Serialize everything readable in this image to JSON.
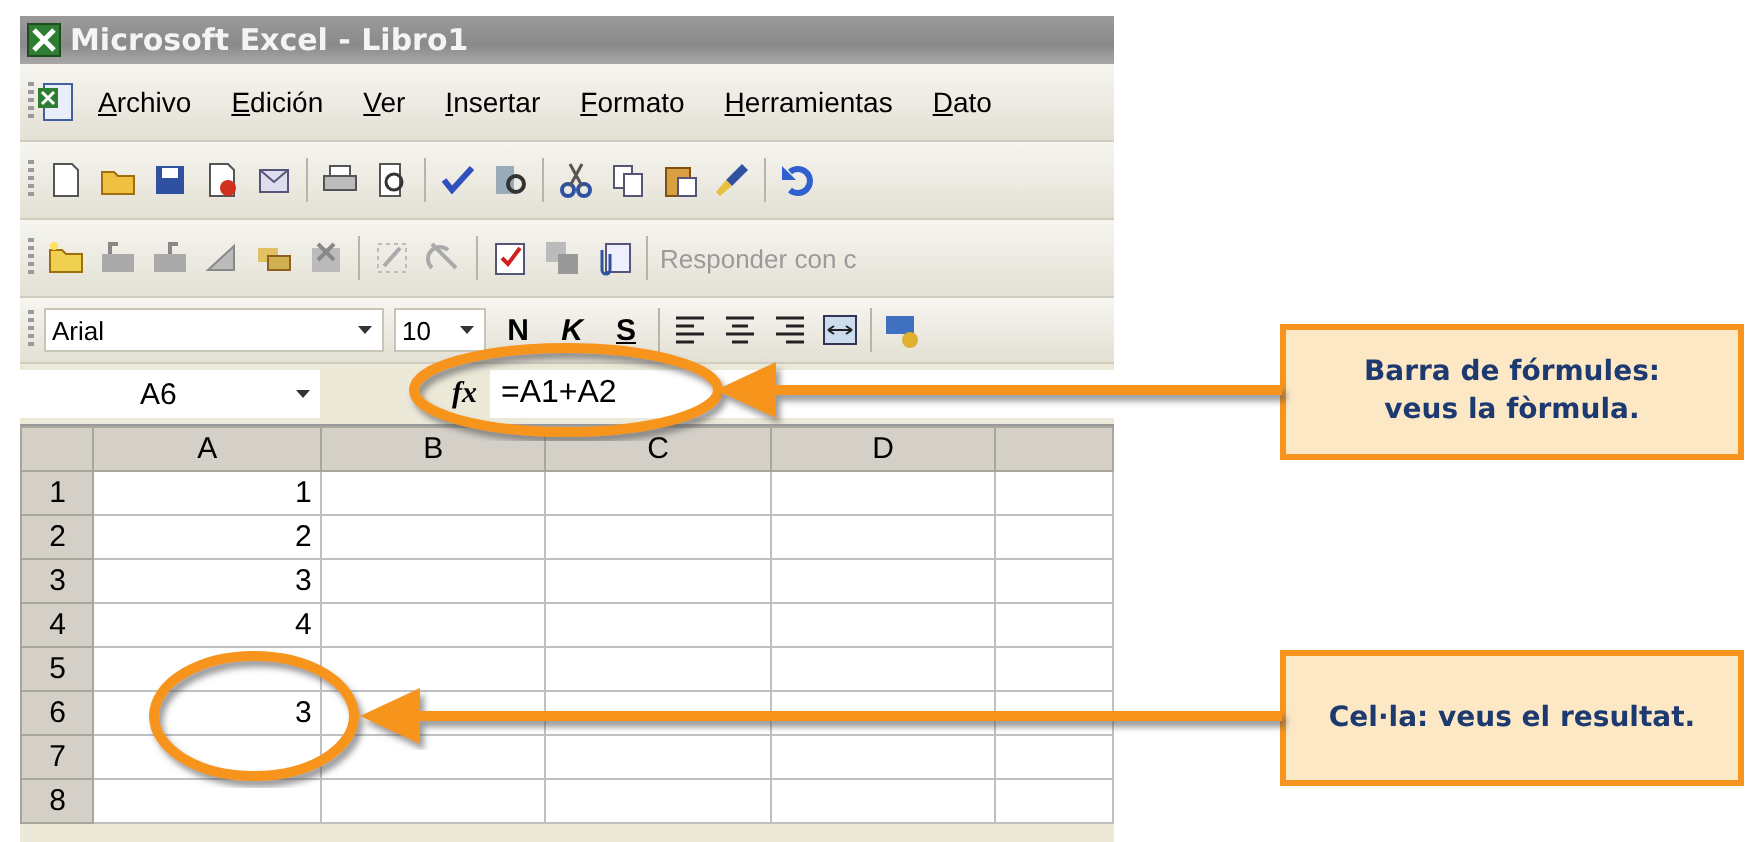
{
  "window": {
    "title": "Microsoft Excel - Libro1"
  },
  "menu": [
    "Archivo",
    "Edición",
    "Ver",
    "Insertar",
    "Formato",
    "Herramientas",
    "Dato"
  ],
  "reviewing_toolbar": {
    "reply_label": "Responder con c"
  },
  "formatting_toolbar": {
    "font": "Arial",
    "size": "10",
    "bold": "N",
    "italic": "K",
    "underline": "S"
  },
  "formula_bar": {
    "name_box": "A6",
    "function_label": "fx",
    "formula": "=A1+A2"
  },
  "sheet": {
    "columns": [
      "A",
      "B",
      "C",
      "D"
    ],
    "rows": [
      {
        "number": "1",
        "value": "1"
      },
      {
        "number": "2",
        "value": "2"
      },
      {
        "number": "3",
        "value": "3"
      },
      {
        "number": "4",
        "value": "4"
      },
      {
        "number": "5"
      },
      {
        "number": "6",
        "value": "3"
      },
      {
        "number": "7"
      },
      {
        "number": "8"
      }
    ]
  },
  "callouts": [
    {
      "text": "Barra de fórmules:\nveus la fòrmula."
    },
    {
      "text": "Cel·la: veus el resultat."
    }
  ]
}
